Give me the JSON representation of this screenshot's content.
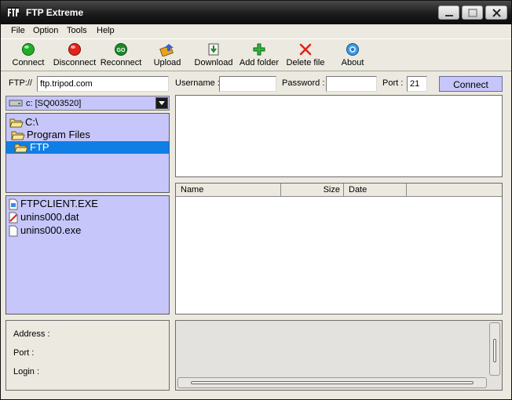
{
  "window": {
    "title": "FTP Extreme"
  },
  "menu": {
    "items": [
      "File",
      "Option",
      "Tools",
      "Help"
    ]
  },
  "toolbar": {
    "buttons": [
      {
        "label": "Connect",
        "icon": "green-circle-icon"
      },
      {
        "label": "Disconnect",
        "icon": "red-circle-icon"
      },
      {
        "label": "Reconnect",
        "icon": "go-icon"
      },
      {
        "label": "Upload",
        "icon": "upload-icon"
      },
      {
        "label": "Download",
        "icon": "download-icon"
      },
      {
        "label": "Add folder",
        "icon": "plus-icon"
      },
      {
        "label": "Delete file",
        "icon": "x-icon"
      },
      {
        "label": "About",
        "icon": "info-icon"
      }
    ]
  },
  "connection": {
    "ftp_label": "FTP://",
    "host_value": "ftp.tripod.com",
    "username_label": "Username :",
    "username_value": "",
    "password_label": "Password :",
    "password_value": "",
    "port_label": "Port :",
    "port_value": "21",
    "connect_label": "Connect"
  },
  "local": {
    "drive": "c: [SQ003520]",
    "directories": [
      {
        "name": "C:\\",
        "selected": false
      },
      {
        "name": "Program Files",
        "selected": false
      },
      {
        "name": "FTP",
        "selected": true
      }
    ],
    "files": [
      "FTPCLIENT.EXE",
      "unins000.dat",
      "unins000.exe"
    ]
  },
  "remote": {
    "columns": [
      "Name",
      "Size",
      "Date"
    ]
  },
  "info": {
    "address_label": "Address :",
    "port_label": "Port :",
    "login_label": "Login :"
  },
  "colors": {
    "pane_background": "#c6c6fa",
    "selection": "#0f7fe6",
    "titlebar": "#1c1c1c"
  }
}
